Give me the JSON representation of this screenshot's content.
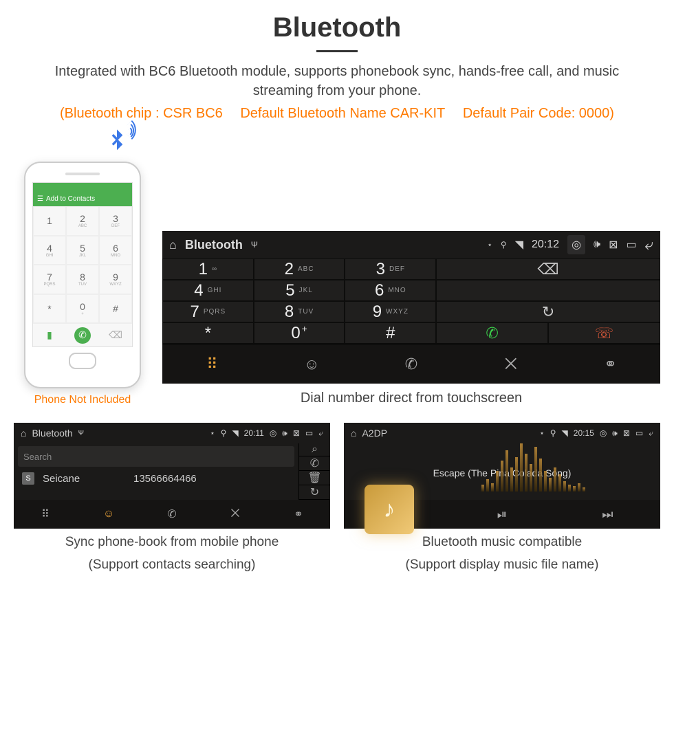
{
  "header": {
    "title": "Bluetooth",
    "description": "Integrated with BC6 Bluetooth module, supports phonebook sync, hands-free call, and music streaming from your phone.",
    "spec_chip": "(Bluetooth chip : CSR BC6",
    "spec_name": "Default Bluetooth Name CAR-KIT",
    "spec_code": "Default Pair Code: 0000)"
  },
  "phone": {
    "addbar": "Add to Contacts",
    "note": "Phone Not Included",
    "keys": [
      {
        "n": "1",
        "s": ""
      },
      {
        "n": "2",
        "s": "ABC"
      },
      {
        "n": "3",
        "s": "DEF"
      },
      {
        "n": "4",
        "s": "GHI"
      },
      {
        "n": "5",
        "s": "JKL"
      },
      {
        "n": "6",
        "s": "MNO"
      },
      {
        "n": "7",
        "s": "PQRS"
      },
      {
        "n": "8",
        "s": "TUV"
      },
      {
        "n": "9",
        "s": "WXYZ"
      },
      {
        "n": "*",
        "s": ""
      },
      {
        "n": "0",
        "s": "+"
      },
      {
        "n": "#",
        "s": ""
      }
    ]
  },
  "dialer": {
    "statusbar": {
      "app": "Bluetooth",
      "time": "20:12"
    },
    "keys": [
      {
        "n": "1",
        "s": "∞"
      },
      {
        "n": "2",
        "s": "ABC"
      },
      {
        "n": "3",
        "s": "DEF"
      },
      {
        "n": "4",
        "s": "GHI"
      },
      {
        "n": "5",
        "s": "JKL"
      },
      {
        "n": "6",
        "s": "MNO"
      },
      {
        "n": "7",
        "s": "PQRS"
      },
      {
        "n": "8",
        "s": "TUV"
      },
      {
        "n": "9",
        "s": "WXYZ"
      },
      {
        "n": "*",
        "s": ""
      },
      {
        "n": "0",
        "s": "+"
      },
      {
        "n": "#",
        "s": ""
      }
    ],
    "caption": "Dial number direct from touchscreen"
  },
  "contacts": {
    "statusbar": {
      "app": "Bluetooth",
      "time": "20:11"
    },
    "search_placeholder": "Search",
    "entry": {
      "initial": "S",
      "name": "Seicane",
      "number": "13566664466"
    },
    "caption1": "Sync phone-book from mobile phone",
    "caption2": "(Support contacts searching)"
  },
  "music": {
    "statusbar": {
      "app": "A2DP",
      "time": "20:15"
    },
    "track": "Escape (The Pina Colada Song)",
    "caption1": "Bluetooth music compatible",
    "caption2": "(Support display music file name)"
  }
}
